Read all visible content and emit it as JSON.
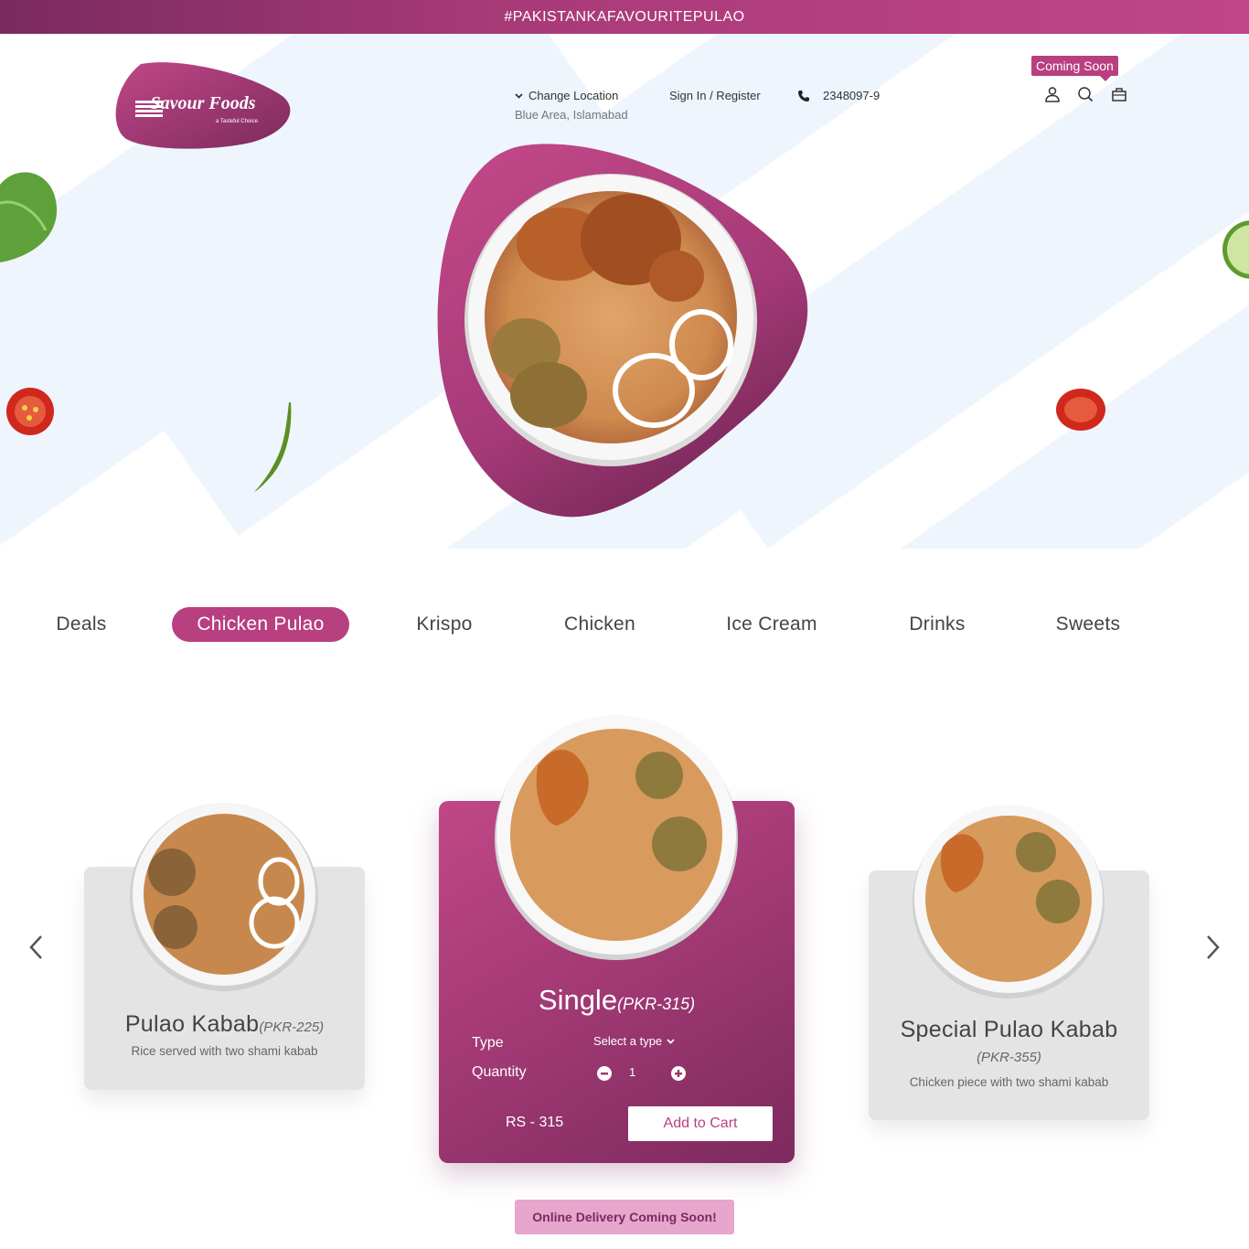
{
  "banner": {
    "text": "#PAKISTANKAFAVOURITEPULAO"
  },
  "logo": {
    "name": "Savour Foods",
    "tagline": "a Tasteful Choice"
  },
  "header": {
    "change_location": "Change Location",
    "current_location": "Blue Area, Islamabad",
    "sign_in": "Sign In / Register",
    "phone": "2348097-9",
    "coming_soon": "Coming Soon"
  },
  "icons": {
    "user": "user-icon",
    "search": "search-icon",
    "cart": "bag-icon",
    "phone": "phone-icon",
    "chevron": "chevron-down-icon"
  },
  "categories": [
    "Deals",
    "Chicken Pulao",
    "Krispo",
    "Chicken",
    "Ice Cream",
    "Drinks",
    "Sweets"
  ],
  "active_category": "Chicken Pulao",
  "products": {
    "left": {
      "name": "Pulao Kabab",
      "price": "(PKR-225)",
      "desc": "Rice served with two shami kabab"
    },
    "center": {
      "name": "Single",
      "price": "(PKR-315)",
      "type_label": "Type",
      "type_placeholder": "Select a type",
      "quantity_label": "Quantity",
      "quantity": "1",
      "total": "RS - 315",
      "add_to_cart": "Add to Cart"
    },
    "right": {
      "name": "Special Pulao Kabab",
      "price": "(PKR-355)",
      "desc": "Chicken piece with two shami kabab"
    }
  },
  "delivery_notice": "Online Delivery Coming Soon!",
  "colors": {
    "brand": "#b83f80",
    "brand_dark": "#7a2a60",
    "card_grey": "#e4e4e4",
    "notice_bg": "#e7a6cc"
  }
}
